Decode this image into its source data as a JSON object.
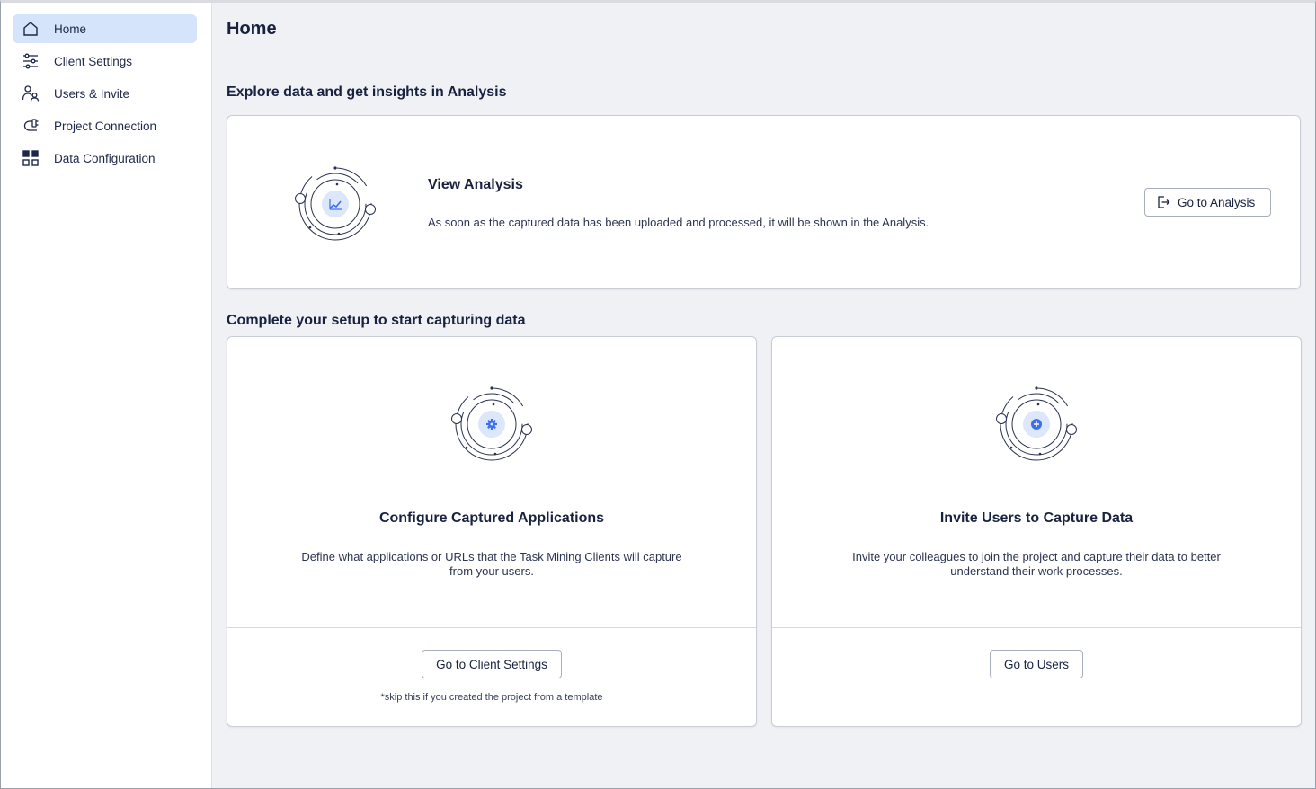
{
  "sidebar": {
    "items": [
      {
        "label": "Home",
        "icon": "home-icon",
        "active": true
      },
      {
        "label": "Client Settings",
        "icon": "sliders-icon",
        "active": false
      },
      {
        "label": "Users & Invite",
        "icon": "users-icon",
        "active": false
      },
      {
        "label": "Project Connection",
        "icon": "plug-icon",
        "active": false
      },
      {
        "label": "Data Configuration",
        "icon": "grid-icon",
        "active": false
      }
    ]
  },
  "main": {
    "title": "Home",
    "analysis_section": {
      "heading": "Explore data and get insights in Analysis",
      "card": {
        "title": "View Analysis",
        "description": "As soon as the captured data has been uploaded and processed, it will be shown in the Analysis.",
        "button_label": "Go to Analysis",
        "icon": "chart-icon"
      }
    },
    "setup_section": {
      "heading": "Complete your setup to start capturing data",
      "cards": [
        {
          "title": "Configure Captured Applications",
          "description": "Define what applications or URLs that the Task Mining Clients will capture from your users.",
          "button_label": "Go to Client Settings",
          "note": "*skip this if you created the project from a template",
          "icon": "gear-icon"
        },
        {
          "title": "Invite Users to Capture Data",
          "description": "Invite your colleagues to join the project and capture their data to better understand their work processes.",
          "button_label": "Go to Users",
          "icon": "plus-icon"
        }
      ]
    }
  },
  "colors": {
    "accent": "#3c6ff0",
    "active_nav_bg": "#d6e4fb",
    "page_bg": "#f0f1f5",
    "text": "#18223f"
  }
}
